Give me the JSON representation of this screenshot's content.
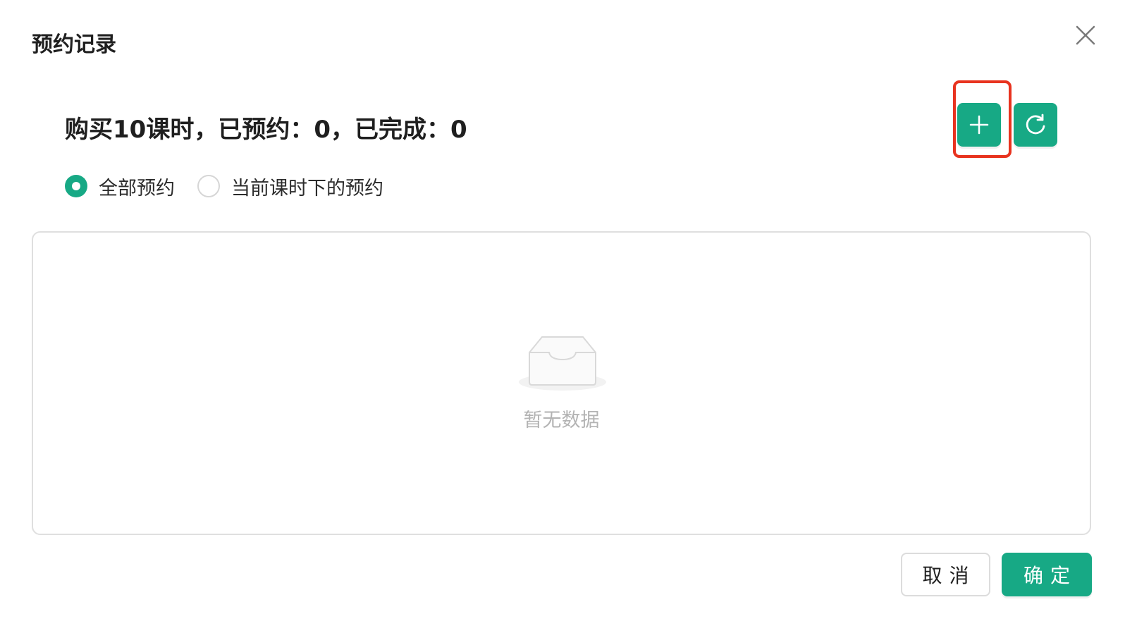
{
  "dialog": {
    "title": "预约记录"
  },
  "summary": {
    "text": "购买10课时，已预约：0，已完成：0"
  },
  "toolbar": {
    "add_icon": "plus-icon",
    "refresh_icon": "refresh-icon",
    "button_color": "#17a985",
    "highlight_color": "#e8331f"
  },
  "filter": {
    "options": [
      {
        "label": "全部预约",
        "selected": true
      },
      {
        "label": "当前课时下的预约",
        "selected": false
      }
    ]
  },
  "table": {
    "empty_text": "暂无数据",
    "empty_icon": "empty-inbox-icon"
  },
  "footer": {
    "cancel_label": "取消",
    "ok_label": "确定"
  }
}
